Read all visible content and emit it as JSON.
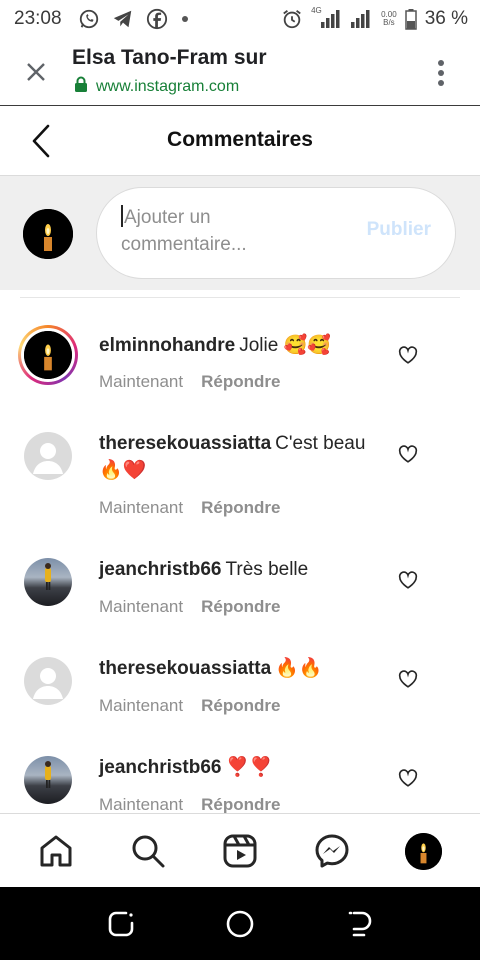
{
  "status_bar": {
    "time": "23:08",
    "network_type": "4G",
    "data_rate_value": "0.00",
    "data_rate_unit": "B/s",
    "battery": "36 %"
  },
  "browser_tab": {
    "title": "Elsa Tano-Fram sur",
    "url": "www.instagram.com"
  },
  "page": {
    "title": "Commentaires"
  },
  "composer": {
    "placeholder": "Ajouter un commentaire...",
    "publish_label": "Publier"
  },
  "comments": [
    {
      "username": "elminnohandre",
      "text": "Jolie 🥰🥰",
      "time": "Maintenant",
      "reply_label": "Répondre",
      "avatar": "candle-story"
    },
    {
      "username": "theresekouassiatta",
      "text": "C'est beau 🔥❤️",
      "time": "Maintenant",
      "reply_label": "Répondre",
      "avatar": "default"
    },
    {
      "username": "jeanchristb66",
      "text": "Très belle",
      "time": "Maintenant",
      "reply_label": "Répondre",
      "avatar": "photo"
    },
    {
      "username": "theresekouassiatta",
      "text": "🔥🔥",
      "time": "Maintenant",
      "reply_label": "Répondre",
      "avatar": "default"
    },
    {
      "username": "jeanchristb66",
      "text": "❣️❣️",
      "time": "Maintenant",
      "reply_label": "Répondre",
      "avatar": "photo"
    }
  ],
  "bottom_nav": [
    "home-icon",
    "search-icon",
    "reels-icon",
    "messenger-icon",
    "profile-avatar"
  ],
  "colors": {
    "publish_disabled": "#cfe4fb",
    "secure_green": "#188038",
    "meta_gray": "#8e8e8e",
    "composer_bg": "#efefef"
  }
}
